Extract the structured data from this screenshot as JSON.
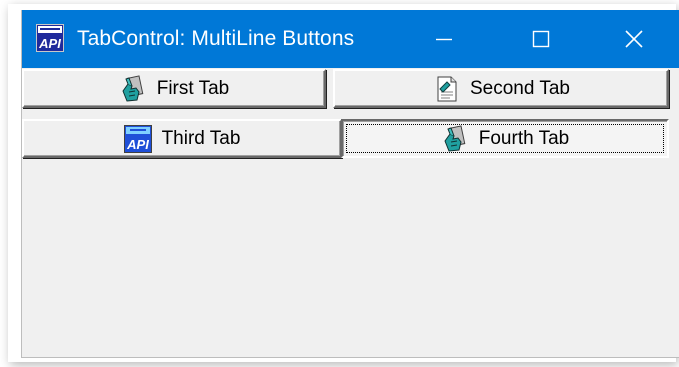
{
  "window": {
    "title": "TabControl: MultiLine Buttons",
    "app_icon": "api-app-icon",
    "titlebar_color": "#0078d7",
    "body_color": "#f0f0f0"
  },
  "caption_buttons": {
    "minimize": "minimize-icon",
    "maximize": "maximize-icon",
    "close": "close-icon"
  },
  "tabs": [
    {
      "label": "First Tab",
      "icon": "hand-card-icon",
      "selected": false
    },
    {
      "label": "Second Tab",
      "icon": "document-icon",
      "selected": false
    },
    {
      "label": "Third Tab",
      "icon": "api-icon",
      "selected": false
    },
    {
      "label": "Fourth Tab",
      "icon": "hand-card-icon",
      "selected": true
    }
  ]
}
